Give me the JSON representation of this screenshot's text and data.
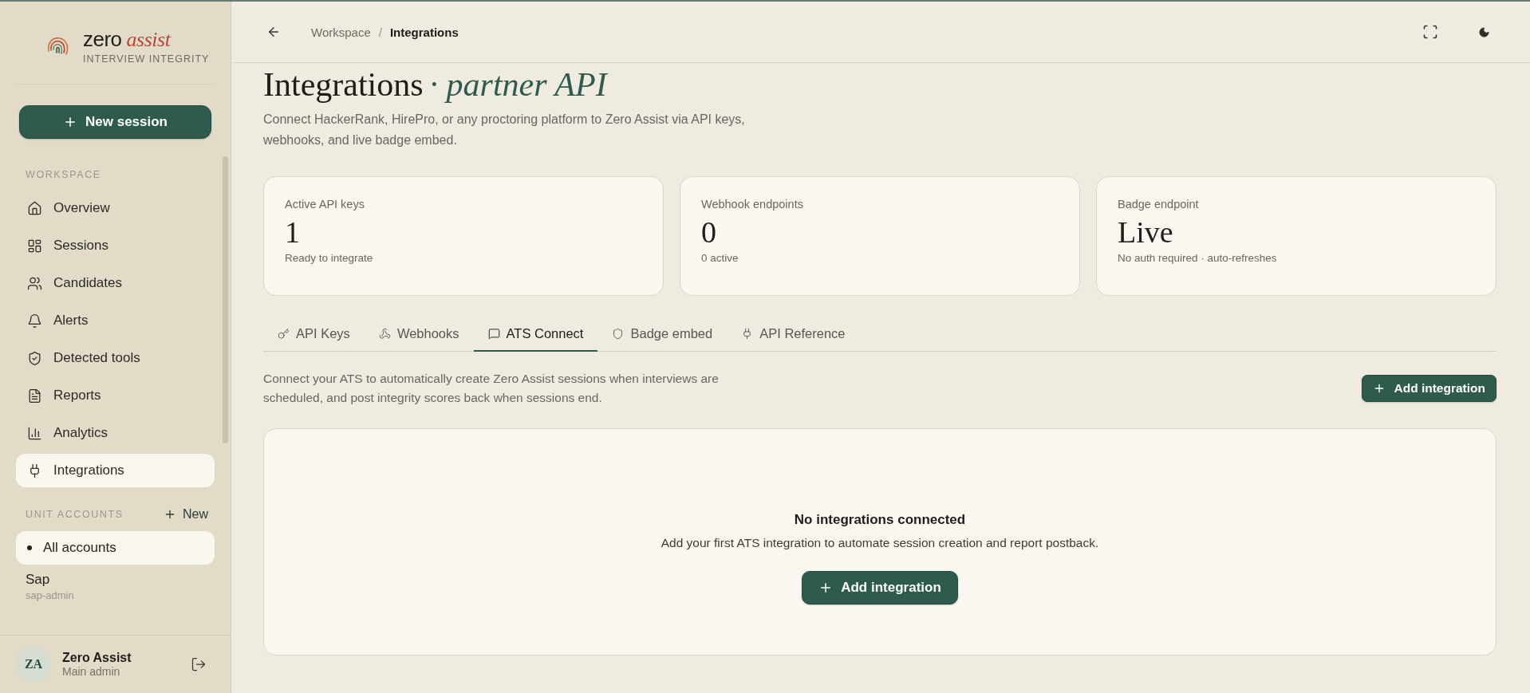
{
  "sidebar": {
    "brand": {
      "name": "zero",
      "accent": "assist",
      "tagline": "INTERVIEW INTEGRITY"
    },
    "new_session_button": "New session",
    "workspace_heading": "WORKSPACE",
    "nav_items": [
      {
        "label": "Overview",
        "selected": false
      },
      {
        "label": "Sessions",
        "selected": false
      },
      {
        "label": "Candidates",
        "selected": false
      },
      {
        "label": "Alerts",
        "selected": false
      },
      {
        "label": "Detected tools",
        "selected": false
      },
      {
        "label": "Reports",
        "selected": false
      },
      {
        "label": "Analytics",
        "selected": false
      },
      {
        "label": "Integrations",
        "selected": true
      }
    ],
    "unit_accounts": {
      "heading": "UNIT ACCOUNTS",
      "new_button": "New",
      "items": [
        {
          "label": "All accounts",
          "selected": true
        },
        {
          "label": "Sap",
          "subtitle": "sap-admin",
          "selected": false
        }
      ]
    },
    "user": {
      "initials": "ZA",
      "name": "Zero Assist",
      "role": "Main admin"
    }
  },
  "header": {
    "separator": "/",
    "breadcrumbs": [
      {
        "label": "Workspace",
        "current": false
      },
      {
        "label": "Integrations",
        "current": true
      }
    ]
  },
  "page": {
    "title": "Integrations",
    "title_accent": "· partner API",
    "description": "Connect HackerRank, HirePro, or any proctoring platform to Zero Assist via API keys, webhooks, and live badge embed.",
    "stats": [
      {
        "label": "Active API keys",
        "value": "1",
        "note": "Ready to integrate"
      },
      {
        "label": "Webhook endpoints",
        "value": "0",
        "note": "0 active"
      },
      {
        "label": "Badge endpoint",
        "value": "Live",
        "note": "No auth required · auto-refreshes"
      }
    ],
    "tabs": [
      {
        "label": "API Keys",
        "selected": false
      },
      {
        "label": "Webhooks",
        "selected": false
      },
      {
        "label": "ATS Connect",
        "selected": true
      },
      {
        "label": "Badge embed",
        "selected": false
      },
      {
        "label": "API Reference",
        "selected": false
      }
    ],
    "tab_intro": "Connect your ATS to automatically create Zero Assist sessions when interviews are scheduled, and post integrity scores back when sessions end.",
    "add_button": "Add integration",
    "empty_state": {
      "title": "No integrations connected",
      "message": "Add your first ATS integration to automate session creation and report postback.",
      "button": "Add integration"
    }
  }
}
